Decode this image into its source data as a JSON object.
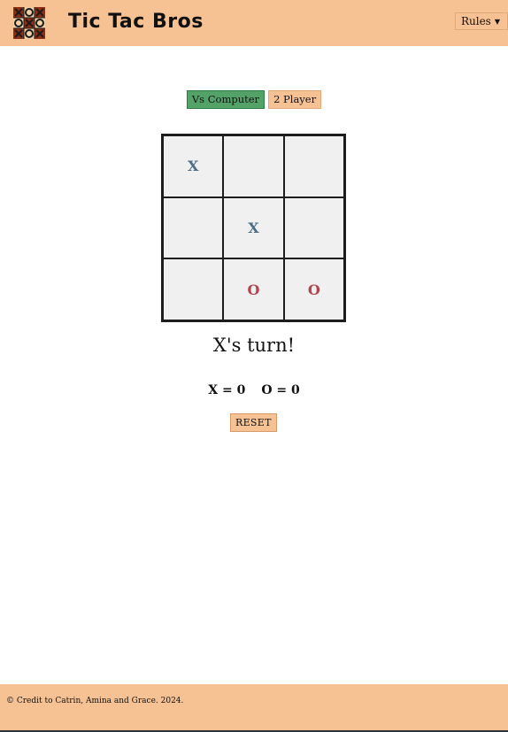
{
  "header": {
    "app_title": "Tic Tac Bros",
    "rules_label": "Rules",
    "logo_icon": "tic-tac-toe-logo-icon"
  },
  "modes": {
    "vs_computer_label": "Vs Computer",
    "two_player_label": "2 Player",
    "active": "vs_computer"
  },
  "board": {
    "cells": [
      "X",
      "",
      "",
      "",
      "X",
      "",
      "",
      "O",
      "O"
    ]
  },
  "status": {
    "turn_text": "X's turn!"
  },
  "score": {
    "x_text": "X = 0",
    "o_text": "O = 0"
  },
  "controls": {
    "reset_label": "RESET"
  },
  "footer": {
    "credit": "© Credit to Catrin, Amina and Grace. 2024."
  },
  "colors": {
    "header_bg": "#f6c193",
    "vs_button_bg": "#53a268",
    "x_color": "#4d6f84",
    "o_color": "#b4434c",
    "board_bg": "#f0f0f0"
  }
}
